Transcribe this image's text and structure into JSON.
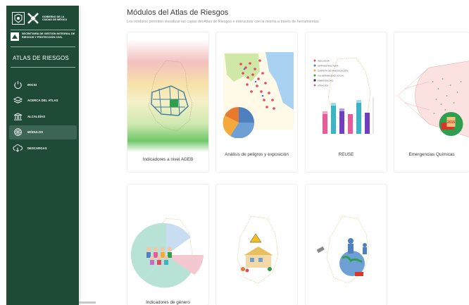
{
  "sidebar": {
    "gov_logo_text": "GOBIERNO DE LA CIUDAD DE MÉXICO",
    "agency_text": "SECRETARÍA DE GESTIÓN INTEGRAL DE RIESGOS Y PROTECCIÓN CIVIL",
    "app_title": "ATLAS DE RIESGOS",
    "items": [
      {
        "label": "INICIO",
        "icon": "power-icon"
      },
      {
        "label": "ACERCA DEL ATLAS",
        "icon": "layers-icon"
      },
      {
        "label": "ALCALDÍAS",
        "icon": "building-icon"
      },
      {
        "label": "MÓDULOS",
        "icon": "gear-icon",
        "active": true
      },
      {
        "label": "DESCARGAS",
        "icon": "cloud-download-icon"
      }
    ]
  },
  "main": {
    "title": "Módulos del Atlas de Riesgos",
    "subtitle": "Los módulos permiten visualizar las capas del Atlas de Riesgos e interactuar con la misma a través de herramientas",
    "cards": [
      {
        "label": "Indicadores a nivel AGEB"
      },
      {
        "label": "Análisis de peligros y exposición"
      },
      {
        "label": "REUSE"
      },
      {
        "label": "Emergencias Químicas"
      },
      {
        "label": "Indicadores de género"
      },
      {
        "label": ""
      },
      {
        "label": ""
      }
    ],
    "reuse_legend": [
      "INDICADOR",
      "INFRAESTRUCTURA",
      "CARPETA DE INVESTIGACIÓN",
      "VULNERABILIDAD SOCIAL",
      "EMERGENCIAS",
      "ATENCIÓN"
    ],
    "sign_year": "2016"
  },
  "colors": {
    "sidebar_bg": "#1f4a35",
    "accent_green": "#2e9e4f",
    "map_line": "#d8c88a"
  }
}
